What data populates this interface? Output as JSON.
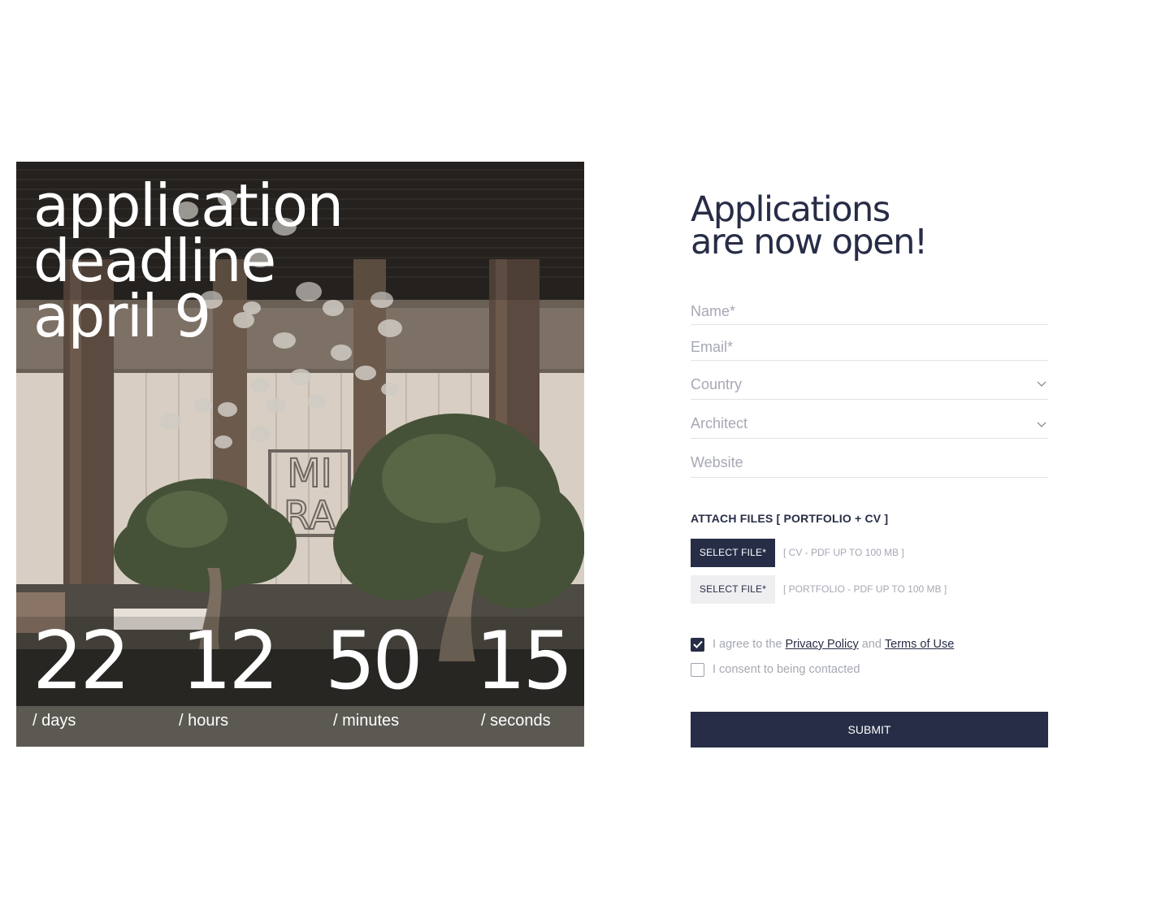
{
  "hero": {
    "title_line1": "application deadline",
    "title_line2": "april 9",
    "logo_text_top": "MI",
    "logo_text_bottom": "RA",
    "countdown": [
      {
        "value": "22",
        "label": "/ days"
      },
      {
        "value": "12",
        "label": "/ hours"
      },
      {
        "value": "50",
        "label": "/ minutes"
      },
      {
        "value": "15",
        "label": "/ seconds"
      }
    ]
  },
  "form": {
    "heading_line1": "Applications",
    "heading_line2": "are now open!",
    "fields": {
      "name_placeholder": "Name*",
      "email_placeholder": "Email*",
      "country_placeholder": "Country",
      "architect_placeholder": "Architect",
      "website_placeholder": "Website"
    },
    "attach_title": "ATTACH FILES [ PORTFOLIO + CV ]",
    "files": [
      {
        "button": "SELECT FILE*",
        "hint": "[ CV - PDF UP TO 100 MB ]"
      },
      {
        "button": "SELECT FILE*",
        "hint": "[ PORTFOLIO - PDF UP TO 100 MB ]"
      }
    ],
    "agree": {
      "checked": true,
      "prefix": "I agree to the",
      "privacy_link": "Privacy Policy",
      "and": "and",
      "terms_link": "Terms of Use"
    },
    "consent": {
      "checked": false,
      "text": "I consent to being contacted"
    },
    "submit_label": "SUBMIT"
  },
  "colors": {
    "brand_navy": "#272d46",
    "placeholder_gray": "#a6a8b4",
    "light_button": "#efeff1"
  }
}
